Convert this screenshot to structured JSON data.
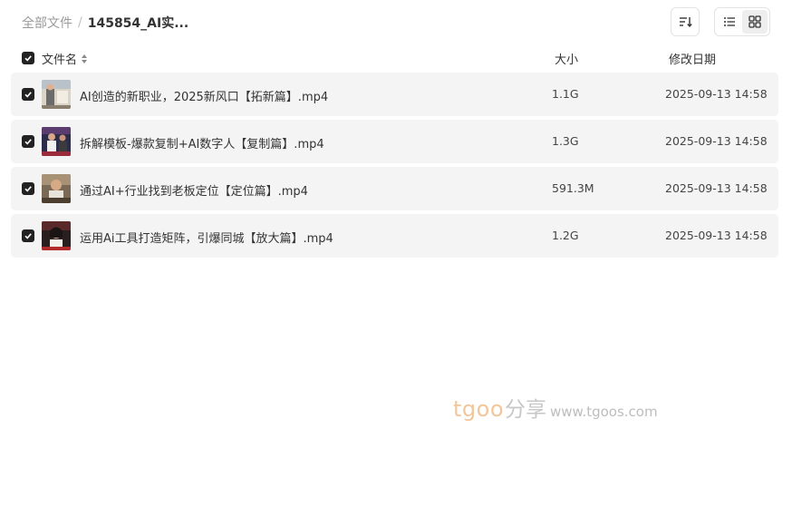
{
  "breadcrumb": {
    "root": "全部文件",
    "separator": "/",
    "current": "145854_AI实..."
  },
  "toolbar": {
    "sort_icon": "sort-descending-icon",
    "list_view_icon": "list-view-icon",
    "grid_view_icon": "grid-view-icon",
    "active_view": "grid"
  },
  "table": {
    "columns": {
      "name": "文件名",
      "size": "大小",
      "date": "修改日期"
    },
    "rows": [
      {
        "name": "AI创造的新职业，2025新风口【拓新篇】.mp4",
        "size": "1.1G",
        "date": "2025-09-13 14:58",
        "checked": true
      },
      {
        "name": "拆解模板-爆款复制+AI数字人【复制篇】.mp4",
        "size": "1.3G",
        "date": "2025-09-13 14:58",
        "checked": true
      },
      {
        "name": "通过AI+行业找到老板定位【定位篇】.mp4",
        "size": "591.3M",
        "date": "2025-09-13 14:58",
        "checked": true
      },
      {
        "name": "运用Ai工具打造矩阵，引爆同城【放大篇】.mp4",
        "size": "1.2G",
        "date": "2025-09-13 14:58",
        "checked": true
      }
    ]
  },
  "watermark": {
    "brand": "tgoo",
    "cn": "分享",
    "url": "www.tgoos.com"
  },
  "colors": {
    "row_background": "#f4f4f4",
    "checkbox": "#222222",
    "watermark_brand": "#f2c69a"
  }
}
